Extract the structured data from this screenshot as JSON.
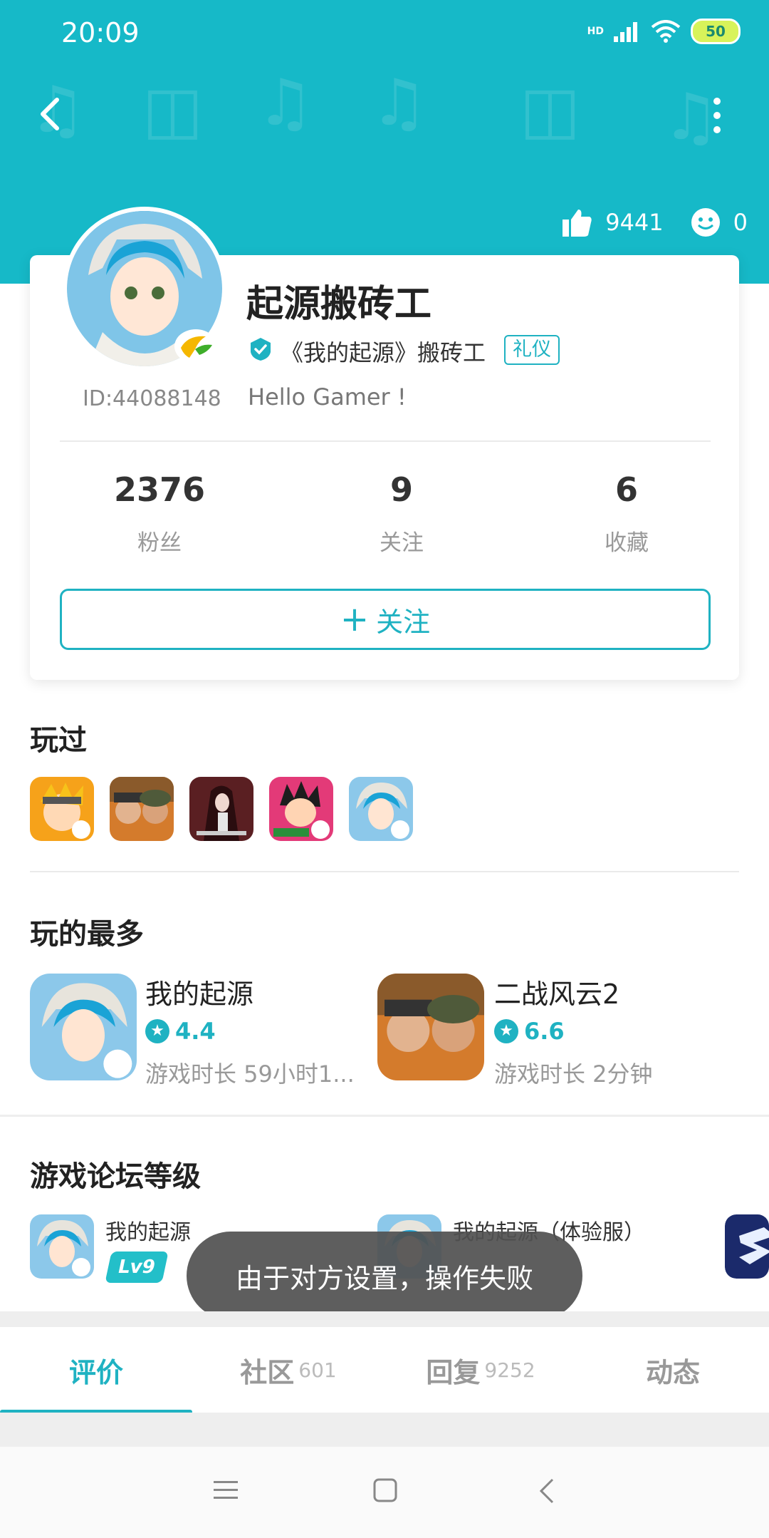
{
  "status_bar": {
    "time": "20:09",
    "network": "HD",
    "battery": "50"
  },
  "header": {
    "likes": "9441",
    "smiles": "0"
  },
  "profile": {
    "name": "起源搬砖工",
    "id": "ID:44088148",
    "verified_text": "《我的起源》搬砖工",
    "tag": "礼仪",
    "bio": "Hello Gamer !"
  },
  "stats": [
    {
      "value": "2376",
      "label": "粉丝"
    },
    {
      "value": "9",
      "label": "关注"
    },
    {
      "value": "6",
      "label": "收藏"
    }
  ],
  "follow_button": {
    "plus": "+",
    "label": "关注"
  },
  "played": {
    "title": "玩过",
    "games": [
      "naruto-game-icon",
      "ww2-game-icon",
      "punishing-game-icon",
      "hunter-game-icon",
      "origin-game-icon"
    ]
  },
  "most_played": {
    "title": "玩的最多",
    "games": [
      {
        "name": "我的起源",
        "rating": "4.4",
        "duration": "游戏时长 59小时1..."
      },
      {
        "name": "二战风云2",
        "rating": "6.6",
        "duration": "游戏时长 2分钟"
      }
    ]
  },
  "forum": {
    "title": "游戏论坛等级",
    "items": [
      {
        "name": "我的起源",
        "level": "Lv9"
      },
      {
        "name": "我的起源（体验服）",
        "level": ""
      }
    ]
  },
  "toast": "由于对方设置，操作失败",
  "tabs": [
    {
      "label": "评价",
      "count": ""
    },
    {
      "label": "社区",
      "count": "601"
    },
    {
      "label": "回复",
      "count": "9252"
    },
    {
      "label": "动态",
      "count": ""
    }
  ],
  "colors": {
    "primary": "#16b9c8",
    "accent": "#1fb2c2"
  }
}
